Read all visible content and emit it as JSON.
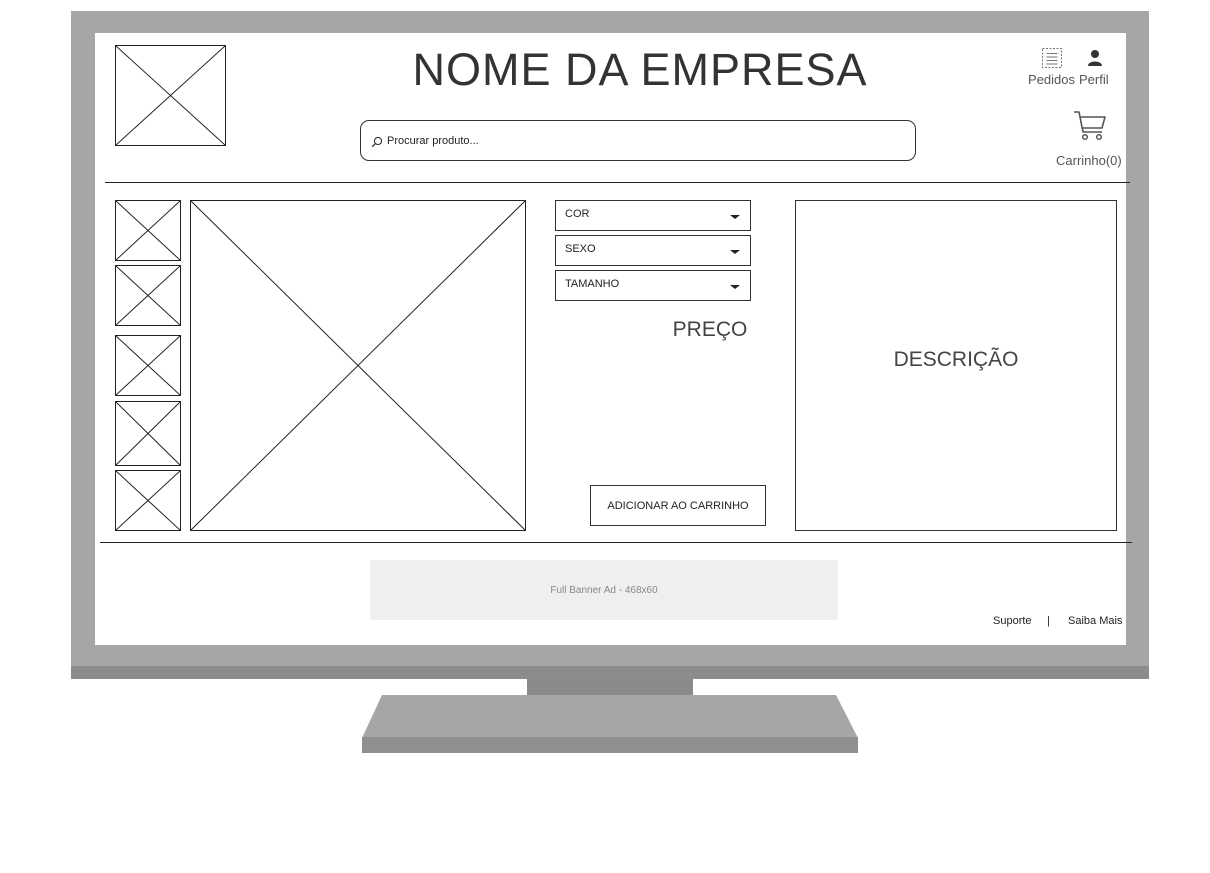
{
  "header": {
    "company_name": "NOME DA EMPRESA",
    "orders_label": "Pedidos",
    "profile_label": "Perfil",
    "cart_label": "Carrinho(0)",
    "orders_icon": "list-icon",
    "profile_icon": "user-icon",
    "cart_icon": "shopping-cart-icon"
  },
  "search": {
    "placeholder": "Procurar produto...",
    "icon": "search-icon"
  },
  "product": {
    "selects": [
      {
        "label": "COR"
      },
      {
        "label": "SEXO"
      },
      {
        "label": "TAMANHO"
      }
    ],
    "price_label": "PREÇO",
    "add_to_cart_label": "ADICIONAR AO CARRINHO",
    "description_label": "DESCRIÇÃO"
  },
  "ad": {
    "label": "Full Banner Ad - 468x60"
  },
  "footer": {
    "support_label": "Suporte",
    "separator": "|",
    "learn_more_label": "Saiba Mais"
  },
  "colors": {
    "bezel": "#a6a6a6",
    "stand": "#8f8f8f",
    "ad_background": "#efefef"
  }
}
